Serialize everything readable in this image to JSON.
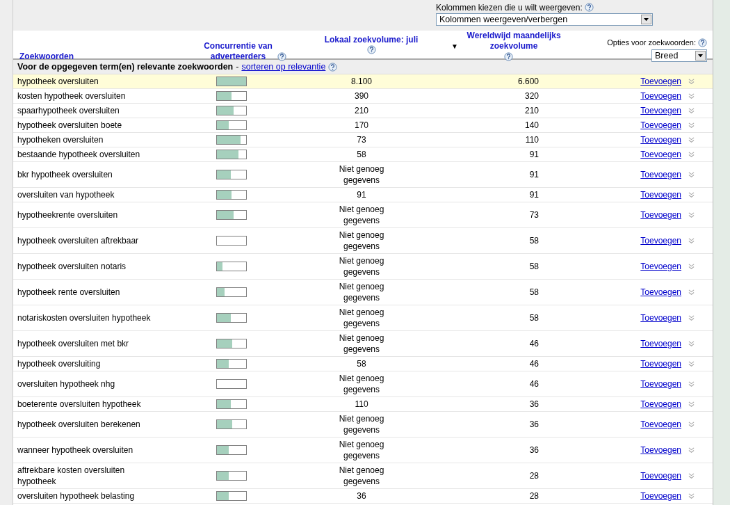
{
  "column_chooser": {
    "label": "Kolommen kiezen die u wilt weergeven:",
    "value": "Kolommen weergeven/verbergen"
  },
  "match_options": {
    "label": "Opties voor zoekwoorden:",
    "value": "Breed"
  },
  "columns": [
    {
      "label": "Zoekwoorden",
      "help": false,
      "sorted": false
    },
    {
      "label": "Concurrentie van adverteerders",
      "help": true,
      "sorted": false
    },
    {
      "label": "Lokaal zoekvolume: juli",
      "help": true,
      "sorted": false
    },
    {
      "label": "Wereldwijd maandelijks zoekvolume",
      "help": true,
      "sorted": true
    }
  ],
  "sort_indicator": "▼",
  "section": {
    "title": "Voor de opgegeven term(en) relevante zoekwoorden",
    "separator": "-",
    "link": "sorteren op relevantie"
  },
  "rows": [
    {
      "keyword": "hypotheek oversluiten",
      "level": 1.0,
      "local": "8.100",
      "global": "6.600",
      "action": "Toevoegen",
      "highlighted": true
    },
    {
      "keyword": "kosten hypotheek oversluiten",
      "level": 0.5,
      "local": "390",
      "global": "320",
      "action": "Toevoegen",
      "highlighted": false
    },
    {
      "keyword": "spaarhypotheek oversluiten",
      "level": 0.58,
      "local": "210",
      "global": "210",
      "action": "Toevoegen",
      "highlighted": false
    },
    {
      "keyword": "hypotheek oversluiten boete",
      "level": 0.4,
      "local": "170",
      "global": "140",
      "action": "Toevoegen",
      "highlighted": false
    },
    {
      "keyword": "hypotheken oversluiten",
      "level": 0.8,
      "local": "73",
      "global": "110",
      "action": "Toevoegen",
      "highlighted": false
    },
    {
      "keyword": "bestaande hypotheek oversluiten",
      "level": 0.73,
      "local": "58",
      "global": "91",
      "action": "Toevoegen",
      "highlighted": false
    },
    {
      "keyword": "bkr hypotheek oversluiten",
      "level": 0.47,
      "local": "Niet genoeg gegevens",
      "global": "91",
      "action": "Toevoegen",
      "highlighted": false
    },
    {
      "keyword": "oversluiten van hypotheek",
      "level": 0.5,
      "local": "91",
      "global": "91",
      "action": "Toevoegen",
      "highlighted": false
    },
    {
      "keyword": "hypotheekrente oversluiten",
      "level": 0.58,
      "local": "Niet genoeg gegevens",
      "global": "73",
      "action": "Toevoegen",
      "highlighted": false
    },
    {
      "keyword": "hypotheek oversluiten aftrekbaar",
      "level": 0,
      "local": "Niet genoeg gegevens",
      "global": "58",
      "action": "Toevoegen",
      "highlighted": false
    },
    {
      "keyword": "hypotheek oversluiten notaris",
      "level": 0.18,
      "local": "Niet genoeg gegevens",
      "global": "58",
      "action": "Toevoegen",
      "highlighted": false
    },
    {
      "keyword": "hypotheek rente oversluiten",
      "level": 0.25,
      "local": "Niet genoeg gegevens",
      "global": "58",
      "action": "Toevoegen",
      "highlighted": false
    },
    {
      "keyword": "notariskosten oversluiten hypotheek",
      "level": 0.47,
      "local": "Niet genoeg gegevens",
      "global": "58",
      "action": "Toevoegen",
      "highlighted": false
    },
    {
      "keyword": "hypotheek oversluiten met bkr",
      "level": 0.52,
      "local": "Niet genoeg gegevens",
      "global": "46",
      "action": "Toevoegen",
      "highlighted": false
    },
    {
      "keyword": "hypotheek oversluiting",
      "level": 0.4,
      "local": "58",
      "global": "46",
      "action": "Toevoegen",
      "highlighted": false
    },
    {
      "keyword": "oversluiten hypotheek nhg",
      "level": 0,
      "local": "Niet genoeg gegevens",
      "global": "46",
      "action": "Toevoegen",
      "highlighted": false
    },
    {
      "keyword": "boeterente oversluiten hypotheek",
      "level": 0.47,
      "local": "110",
      "global": "36",
      "action": "Toevoegen",
      "highlighted": false
    },
    {
      "keyword": "hypotheek oversluiten berekenen",
      "level": 0.52,
      "local": "Niet genoeg gegevens",
      "global": "36",
      "action": "Toevoegen",
      "highlighted": false
    },
    {
      "keyword": "wanneer hypotheek oversluiten",
      "level": 0.4,
      "local": "Niet genoeg gegevens",
      "global": "36",
      "action": "Toevoegen",
      "highlighted": false
    },
    {
      "keyword": "aftrekbare kosten oversluiten hypotheek",
      "level": 0.4,
      "local": "Niet genoeg gegevens",
      "global": "28",
      "action": "Toevoegen",
      "highlighted": false
    },
    {
      "keyword": "oversluiten hypotheek belasting",
      "level": 0.4,
      "local": "36",
      "global": "28",
      "action": "Toevoegen",
      "highlighted": false
    }
  ]
}
